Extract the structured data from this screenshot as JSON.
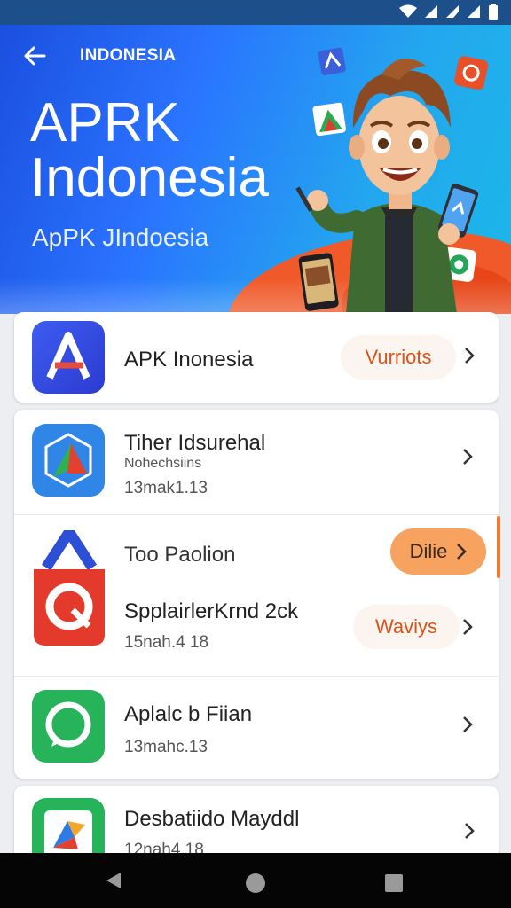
{
  "status_bar": {
    "icons": [
      "wifi-icon",
      "signal-icon",
      "signal-icon",
      "signal-icon",
      "battery-icon"
    ]
  },
  "header": {
    "small_title": "INDONESIA",
    "title_line1": "APRK",
    "title_line2": "Indonesia",
    "subtitle": "ApPK JIndoesia"
  },
  "apps": [
    {
      "title": "APK Inonesia",
      "sub": "",
      "meta": "",
      "badge": "Vurriots"
    },
    {
      "title": "Tiher Idsurehal",
      "sub": "Nohechsiins",
      "meta": "13mak1.13",
      "badge": ""
    },
    {
      "title": "Too Paolion",
      "sub": "",
      "meta": "",
      "badge": "Dilie"
    },
    {
      "title": "SpplairlerKrnd 2ck",
      "sub": "",
      "meta": "15nah.4 18",
      "badge": "Waviys"
    },
    {
      "title": "Aplalc b Fiian",
      "sub": "",
      "meta": "13mahc.13",
      "badge": ""
    },
    {
      "title": "Desbatiido Mayddl",
      "sub": "",
      "meta": "12nah4.18",
      "badge": ""
    }
  ],
  "colors": {
    "accent": "#f07a2a",
    "hero_blue": "#2a74ff",
    "badge_text": "#d9541a"
  }
}
